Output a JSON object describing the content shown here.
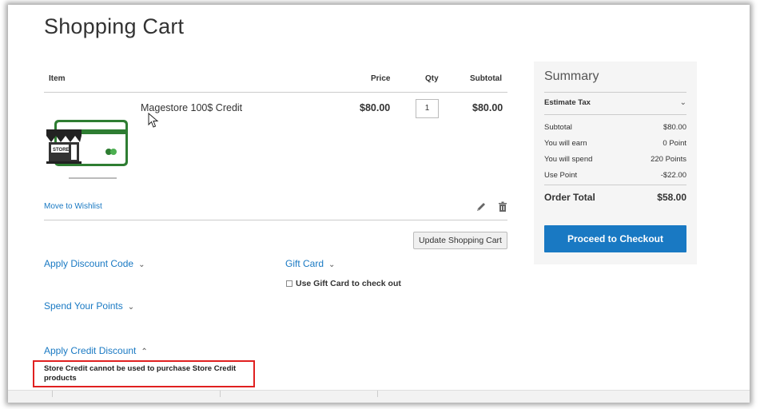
{
  "page": {
    "title": "Shopping Cart"
  },
  "table": {
    "headers": {
      "item": "Item",
      "price": "Price",
      "qty": "Qty",
      "subtotal": "Subtotal"
    },
    "rows": [
      {
        "name": "Magestore 100$ Credit",
        "price": "$80.00",
        "qty": "1",
        "subtotal": "$80.00"
      }
    ]
  },
  "actions": {
    "move_to_wishlist": "Move to Wishlist",
    "edit_icon": "pencil-icon",
    "delete_icon": "trash-icon",
    "update_cart": "Update Shopping Cart"
  },
  "discounts": {
    "apply_discount_code": "Apply Discount Code",
    "gift_card": "Gift Card",
    "use_gift_card": "Use Gift Card to check out",
    "spend_points": "Spend Your Points",
    "apply_credit": "Apply Credit Discount",
    "credit_notice": "Store Credit cannot be used to purchase Store Credit products"
  },
  "summary": {
    "title": "Summary",
    "estimate_tax": "Estimate Tax",
    "lines": [
      {
        "label": "Subtotal",
        "value": "$80.00"
      },
      {
        "label": "You will earn",
        "value": "0 Point"
      },
      {
        "label": "You will spend",
        "value": "220 Points"
      },
      {
        "label": "Use Point",
        "value": "-$22.00"
      }
    ],
    "order_total_label": "Order Total",
    "order_total_value": "$58.00",
    "checkout_button": "Proceed to Checkout"
  },
  "colors": {
    "accent": "#1979c3",
    "alert": "#e02020",
    "card_green": "#2e7d32"
  }
}
